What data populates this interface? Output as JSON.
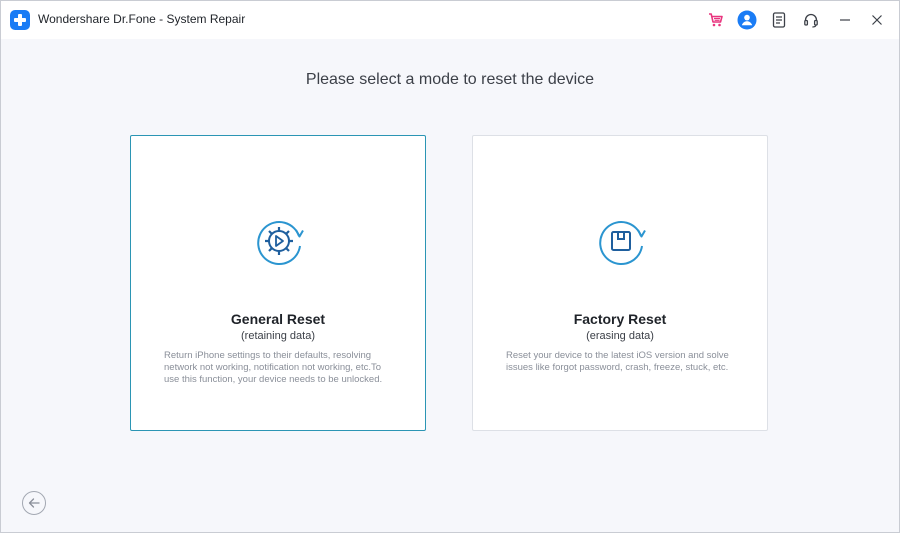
{
  "window": {
    "title": "Wondershare Dr.Fone - System Repair"
  },
  "titlebar_icons": [
    "cart-icon",
    "user-avatar-icon",
    "notes-icon",
    "headset-icon",
    "minimize-icon",
    "close-icon"
  ],
  "colors": {
    "accent": "#1a7cf5",
    "card_selected_border": "#2b95b4",
    "icon_blue": "#2b95d0",
    "cart": "#e8357e"
  },
  "main": {
    "heading": "Please select a mode to reset the device",
    "modes": [
      {
        "title": "General Reset",
        "subtitle": "(retaining data)",
        "description": [
          "Return iPhone settings to their defaults, resolving",
          "network not working, notification not working, etc.To",
          "use this function, your device needs to be unlocked."
        ],
        "icon": "gear-refresh-icon",
        "selected": true
      },
      {
        "title": "Factory Reset",
        "subtitle": "(erasing data)",
        "description": [
          "Reset your device to the latest iOS version and solve",
          "issues like forgot password, crash, freeze, stuck, etc."
        ],
        "icon": "box-refresh-icon",
        "selected": false
      }
    ]
  },
  "footer": {
    "back_icon": "back-arrow-icon"
  }
}
